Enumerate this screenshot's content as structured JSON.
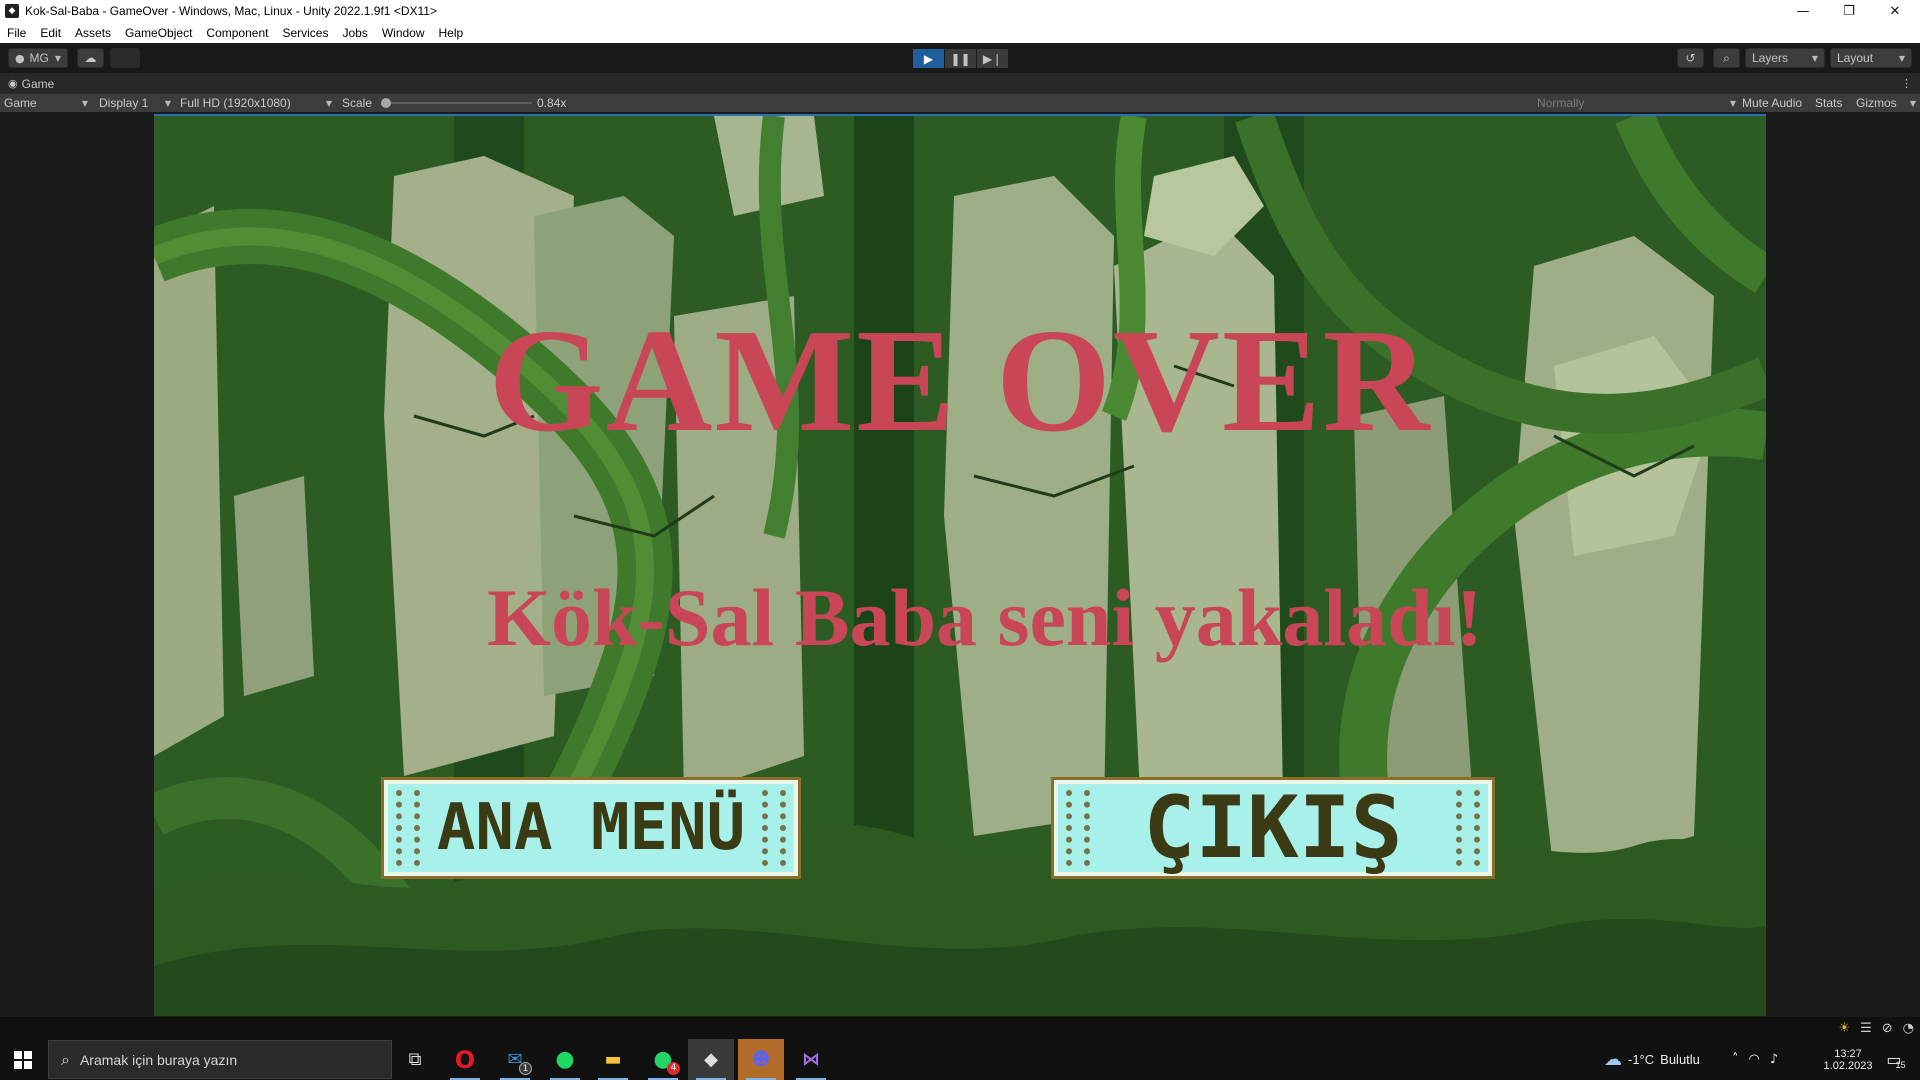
{
  "window": {
    "title": "Kok-Sal-Baba - GameOver - Windows, Mac, Linux - Unity 2022.1.9f1 <DX11>",
    "controls": [
      "—",
      "❐",
      "✕"
    ]
  },
  "menu": [
    "File",
    "Edit",
    "Assets",
    "GameObject",
    "Component",
    "Services",
    "Jobs",
    "Window",
    "Help"
  ],
  "toolbar": {
    "account_label": "MG",
    "layers_label": "Layers",
    "layout_label": "Layout"
  },
  "game_view": {
    "tab_label": "Game",
    "mode": "Game",
    "display": "Display 1",
    "resolution": "Full HD (1920x1080)",
    "scale_label": "Scale",
    "scale_value": "0.84x",
    "play_focus": "Normally",
    "mute_audio": "Mute Audio",
    "stats": "Stats",
    "gizmos": "Gizmos"
  },
  "game": {
    "title": "GAME OVER",
    "subtitle": "Kök-Sal Baba seni yakaladı!",
    "main_menu_button": "ANA MENÜ",
    "exit_button": "ÇIKIŞ",
    "title_color": "#c94656"
  },
  "taskbar": {
    "search_placeholder": "Aramak için buraya yazın",
    "mail_badge": "1",
    "whatsapp_badge": "4",
    "weather_temp": "-1°C",
    "weather_text": "Bulutlu",
    "time": "13:27",
    "date": "1.02.2023",
    "notification_count": "15"
  }
}
